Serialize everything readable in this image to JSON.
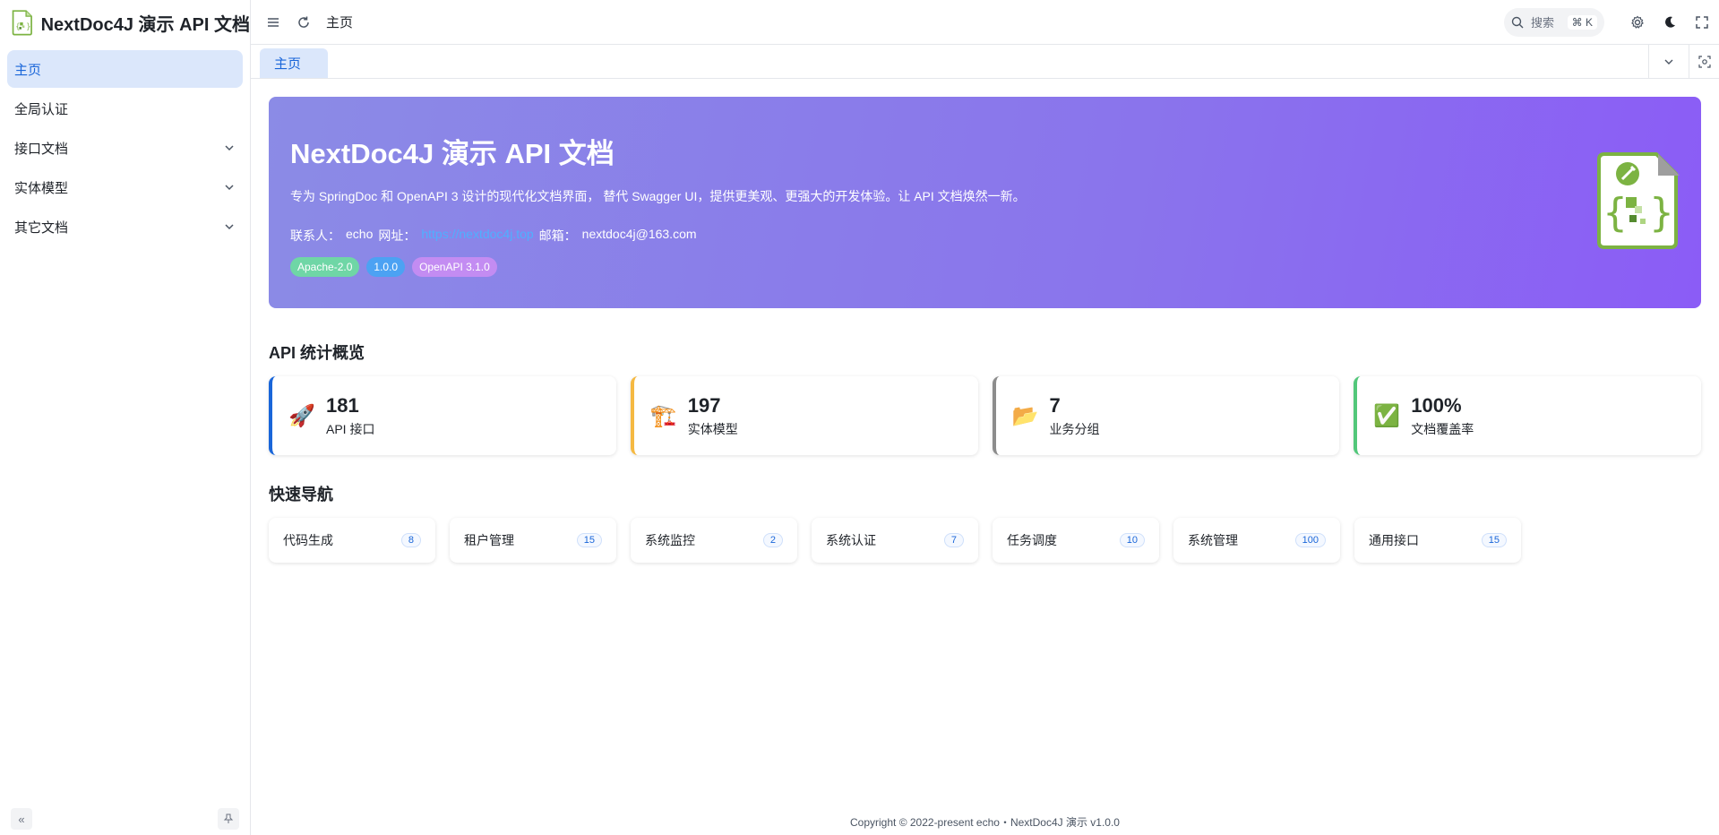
{
  "app": {
    "title": "NextDoc4J 演示 API 文档"
  },
  "sidebar": {
    "items": [
      {
        "label": "主页",
        "active": true
      },
      {
        "label": "全局认证"
      },
      {
        "label": "接口文档",
        "expandable": true
      },
      {
        "label": "实体模型",
        "expandable": true
      },
      {
        "label": "其它文档",
        "expandable": true
      }
    ],
    "collapse_icon": "«",
    "pin_icon": "pin-icon"
  },
  "topbar": {
    "breadcrumb": "主页",
    "search_placeholder": "搜索",
    "search_shortcut": "⌘ K"
  },
  "tabs": [
    {
      "label": "主页"
    }
  ],
  "hero": {
    "title": "NextDoc4J 演示 API 文档",
    "description": "专为 SpringDoc 和 OpenAPI 3 设计的现代化文档界面， 替代 Swagger UI，提供更美观、更强大的开发体验。让 API 文档焕然一新。",
    "contact_label": "联系人：",
    "contact_name": "echo",
    "url_label": "网址：",
    "url": "https://nextdoc4j.top",
    "email_label": "邮箱：",
    "email": "nextdoc4j@163.com",
    "badges": [
      {
        "label": "Apache-2.0",
        "color": "#6fd6a6"
      },
      {
        "label": "1.0.0",
        "color": "#4ca2f3"
      },
      {
        "label": "OpenAPI 3.1.0",
        "color": "#c38cf2"
      }
    ]
  },
  "stats": {
    "title": "API 统计概览",
    "items": [
      {
        "icon": "🚀",
        "value": "181",
        "label": "API 接口",
        "color": "#1a66d9"
      },
      {
        "icon": "🏗️",
        "value": "197",
        "label": "实体模型",
        "color": "#f5b942"
      },
      {
        "icon": "📂",
        "value": "7",
        "label": "业务分组",
        "color": "#8c8c8c"
      },
      {
        "icon": "✅",
        "value": "100%",
        "label": "文档覆盖率",
        "color": "#52c77a"
      }
    ]
  },
  "quicknav": {
    "title": "快速导航",
    "items": [
      {
        "label": "代码生成",
        "count": "8"
      },
      {
        "label": "租户管理",
        "count": "15"
      },
      {
        "label": "系统监控",
        "count": "2"
      },
      {
        "label": "系统认证",
        "count": "7"
      },
      {
        "label": "任务调度",
        "count": "10"
      },
      {
        "label": "系统管理",
        "count": "100"
      },
      {
        "label": "通用接口",
        "count": "15"
      }
    ]
  },
  "footer": {
    "text": "Copyright © 2022-present echo・NextDoc4J 演示 v1.0.0"
  }
}
